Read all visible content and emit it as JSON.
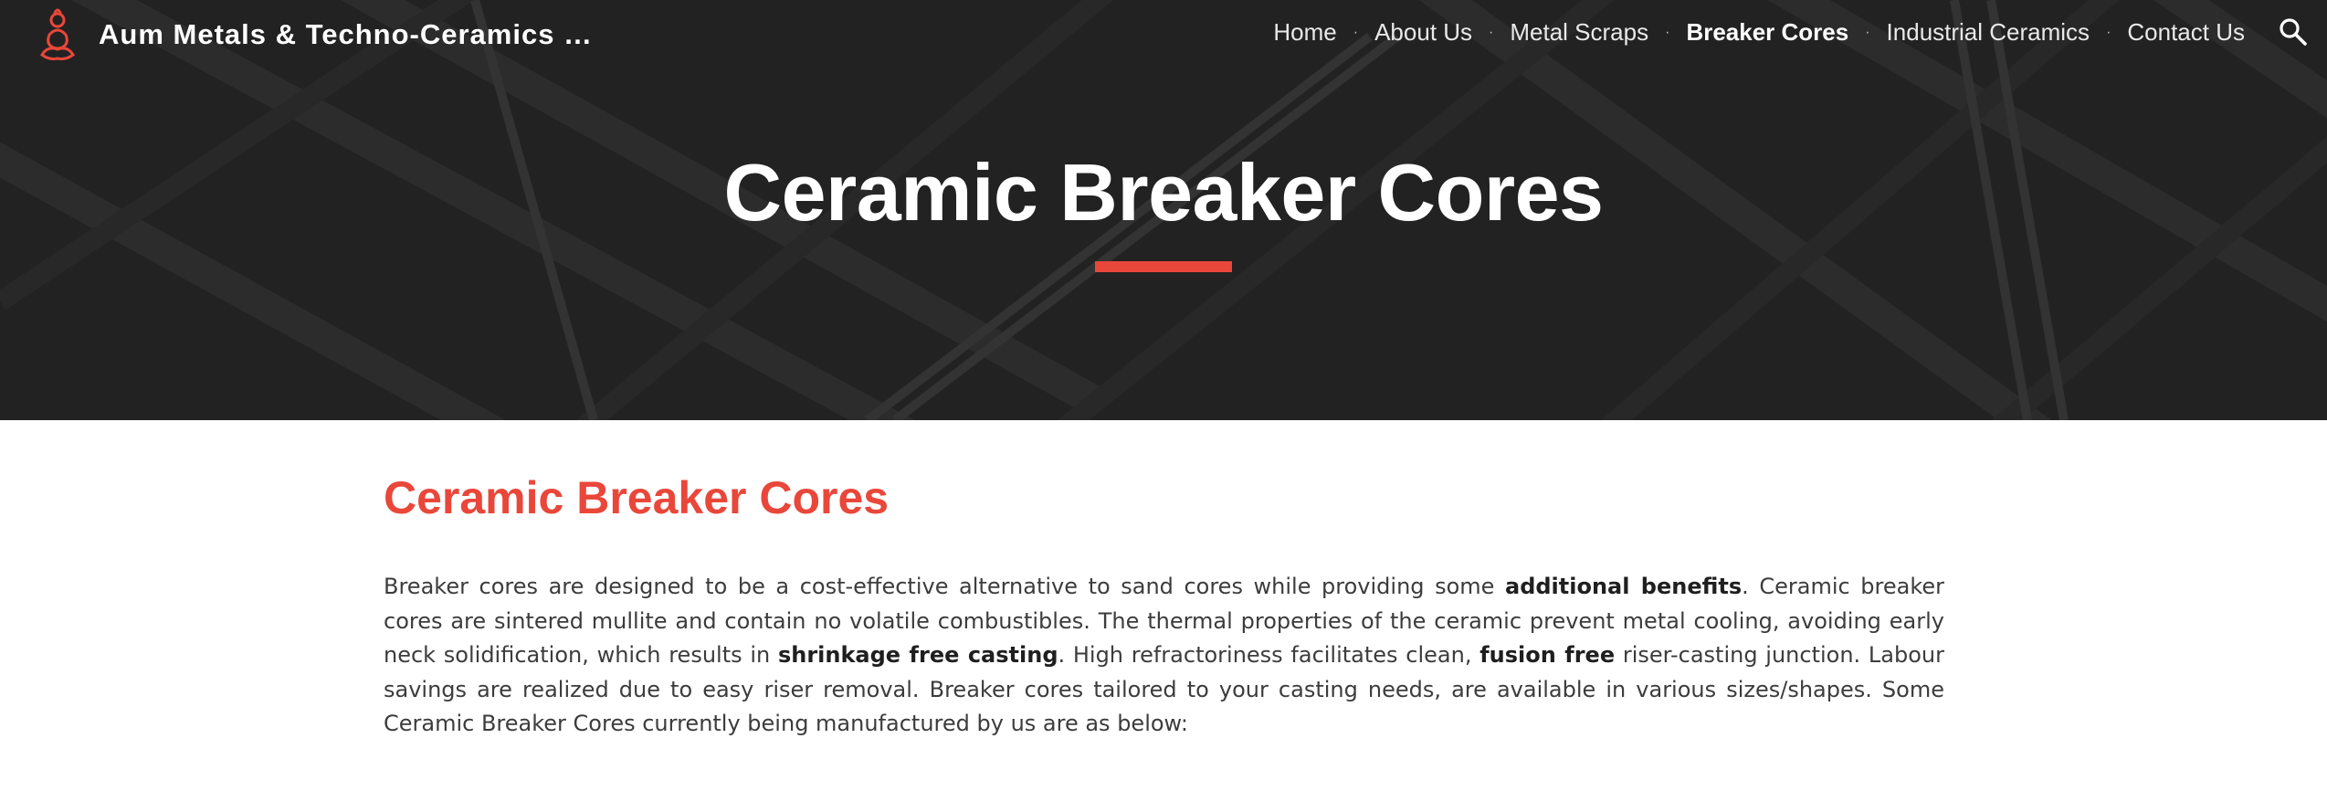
{
  "site": {
    "title": "Aum Metals & Techno-Ceramics …"
  },
  "nav": {
    "items": [
      {
        "label": "Home"
      },
      {
        "label": "About Us"
      },
      {
        "label": "Metal Scraps"
      },
      {
        "label": "Breaker Cores",
        "active": true
      },
      {
        "label": "Industrial Ceramics"
      },
      {
        "label": "Contact Us"
      }
    ],
    "separator": "·"
  },
  "hero": {
    "title": "Ceramic Breaker Cores"
  },
  "main": {
    "heading": "Ceramic Breaker Cores",
    "paragraph": {
      "p1": "Breaker cores are designed to be a cost-effective alternative to sand cores while providing some ",
      "b1": "additional benefits",
      "p2": ". Ceramic breaker cores are sintered mullite and contain no volatile combustibles. The thermal properties of the ceramic prevent metal cooling, avoiding early neck solidification, which results in ",
      "b2": "shrinkage free casting",
      "p3": ". High refractoriness facilitates clean, ",
      "b3": "fusion free",
      "p4": " riser-casting junction. Labour savings are realized due to easy riser removal. Breaker cores tailored to your casting needs, are available in various sizes/shapes. Some Ceramic Breaker Cores currently being manufactured by us are as below:"
    }
  },
  "colors": {
    "accent": "#e9473a",
    "hero_bg": "#262626",
    "nav_text": "#e9e9e9",
    "body_text": "#3c3c3c"
  },
  "icons": {
    "logo": "buddha-logo-icon",
    "search": "search-icon"
  }
}
